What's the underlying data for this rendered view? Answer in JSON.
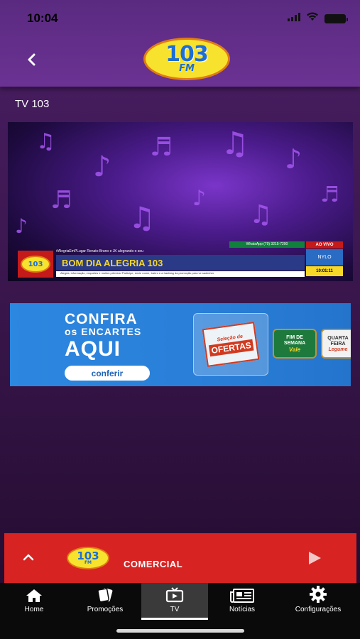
{
  "status_bar": {
    "time": "10:04"
  },
  "header": {
    "logo_number": "103",
    "logo_suffix": "FM",
    "section_title": "TV 103"
  },
  "video": {
    "hashtag_line": "#AlegriaEmPLugar Renato Bruno e JK alegrando o seu",
    "whatsapp": "WhatsApp (79) 3215-7200",
    "live_badge": "AO VIVO",
    "program_title": "BOM DIA ALEGRIA 103",
    "ticker": "Alegria, informação, enquetes e muitos prêmios! Participe, envie nome, bairro e a hashtag da promoção para ve sadecher",
    "sponsor": "NYLO",
    "clock": "10:01:11",
    "logo_number": "103"
  },
  "ad_banner": {
    "line1": "CONFIRA",
    "line2": "os ENCARTES",
    "line3": "AQUI",
    "button_label": "conferir",
    "card1_top": "Seleção de",
    "card1_main": "OFERTAS",
    "card2_top": "FIM DE",
    "card2_mid": "SEMANA",
    "card2_script": "Vale",
    "card3_top": "QUARTA",
    "card3_mid": "FEIRA",
    "card3_script": "Legume"
  },
  "player": {
    "logo_number": "103",
    "logo_suffix": "FM",
    "title": "COMERCIAL",
    "icons": {
      "expand": "chevron-up-icon",
      "play": "play-icon"
    }
  },
  "tab_bar": {
    "tabs": [
      {
        "label": "Home",
        "icon": "home-icon",
        "active": false
      },
      {
        "label": "Promoções",
        "icon": "tickets-icon",
        "active": false
      },
      {
        "label": "TV",
        "icon": "tv-icon",
        "active": true
      },
      {
        "label": "Notícias",
        "icon": "newspaper-icon",
        "active": false
      },
      {
        "label": "Configurações",
        "icon": "gear-icon",
        "active": false
      }
    ]
  },
  "colors": {
    "header_purple": "#5a2a80",
    "background_purple": "#3c1750",
    "player_red": "#d82323",
    "ad_blue": "#2a7fd8",
    "logo_yellow": "#f7e22d",
    "logo_blue": "#1d6fd3",
    "tab_bar_black": "#0a0a0a"
  }
}
